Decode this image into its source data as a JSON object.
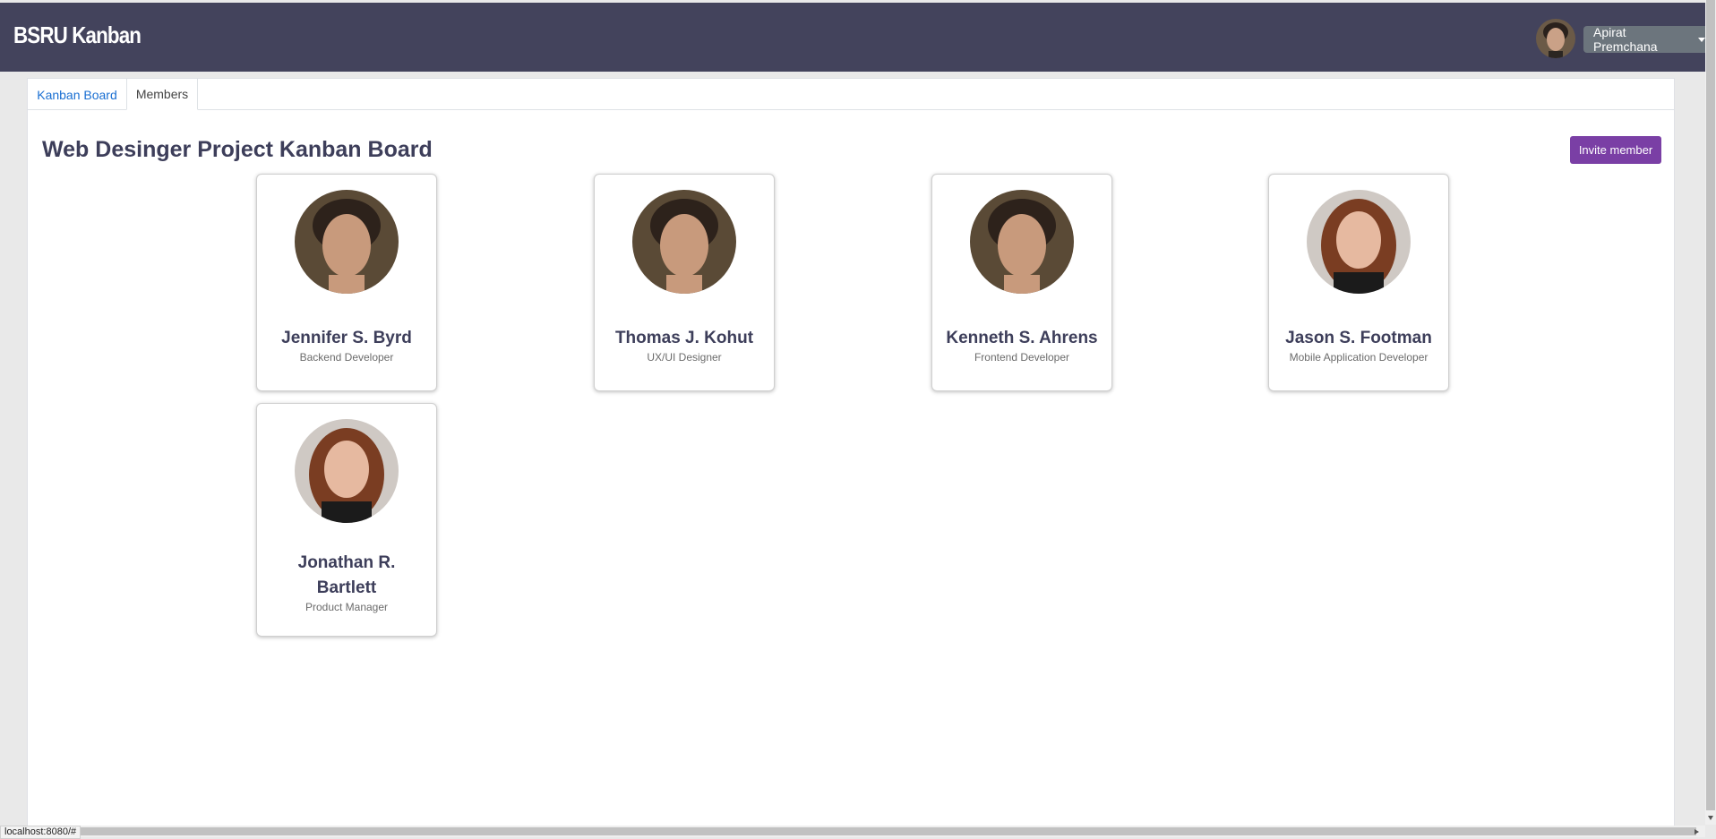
{
  "app": {
    "brand": "BSRU Kanban"
  },
  "user": {
    "name": "Apirat Premchana"
  },
  "tabs": [
    {
      "label": "Kanban Board",
      "active": false
    },
    {
      "label": "Members",
      "active": true
    }
  ],
  "main": {
    "title": "Web Desinger Project Kanban Board",
    "invite_label": "Invite member"
  },
  "members": [
    {
      "name": "Jennifer S. Byrd",
      "role": "Backend Developer",
      "avatar": "man"
    },
    {
      "name": "Thomas J. Kohut",
      "role": "UX/UI Designer",
      "avatar": "man"
    },
    {
      "name": "Kenneth S. Ahrens",
      "role": "Frontend Developer",
      "avatar": "man"
    },
    {
      "name": "Jason S. Footman",
      "role": "Mobile Application Developer",
      "avatar": "woman"
    },
    {
      "name": "Jonathan R. Bartlett",
      "role": "Product Manager",
      "avatar": "woman"
    }
  ],
  "status_bar": {
    "url": "localhost:8080/#"
  },
  "colors": {
    "navbar": "#43435c",
    "invite_button": "#7a3fa5",
    "title": "#3d3e5a"
  }
}
